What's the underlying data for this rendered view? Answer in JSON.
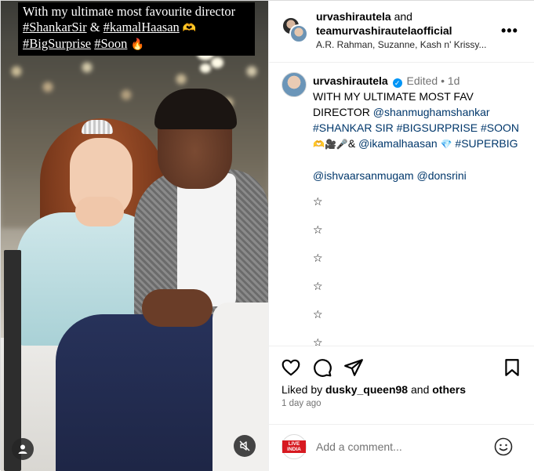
{
  "media": {
    "caption_line1": "With my ultimate most favourite director",
    "caption_tag1": "#ShankarSir",
    "caption_amp": "&",
    "caption_tag2": "#kamalHaasan",
    "caption_emoji1": "🫶",
    "caption_tag3": "#BigSurprise",
    "caption_tag4": "#Soon",
    "caption_emoji2": "🔥",
    "user_tags_icon": "person-icon",
    "mute_icon": "speaker-muted-icon"
  },
  "header": {
    "author1": "urvashirautela",
    "and_label": "and",
    "author2": "teamurvashirautelaofficial",
    "audio": "A.R. Rahman, Suzanne, Kash n' Krissy...",
    "more_label": "•••"
  },
  "post": {
    "username": "urvashirautela",
    "verified_mark": "✓",
    "edited_label": "Edited",
    "separator": "•",
    "age": "1d",
    "text_line": "WITH MY ULTIMATE MOST FAV DIRECTOR",
    "mention1": "@shanmughamshankar",
    "tag_shankar": "#SHANKAR",
    "sir": "SIR",
    "tag_bigsurprise": "#BIGSURPRISE",
    "tag_soon": "#SOON",
    "emojis": "🫶🎥🎤",
    "amp": "&",
    "mention2": "@ikamalhaasan",
    "gem": "💎",
    "tag_superbig": "#SUPERBIG",
    "mention3": "@ishvaarsanmugam",
    "mention4": "@donsrini",
    "stars": [
      "☆",
      "☆",
      "☆",
      "☆",
      "☆",
      "☆"
    ]
  },
  "actions": {
    "icons": [
      "heart-icon",
      "comment-icon",
      "share-icon",
      "bookmark-icon"
    ],
    "liked_prefix": "Liked by",
    "liked_user": "dusky_queen98",
    "liked_and": "and",
    "liked_others": "others",
    "time": "1 day ago"
  },
  "comment": {
    "avatar_text": "LIVE INDIA",
    "placeholder": "Add a comment...",
    "emoji_icon": "smiley-icon"
  },
  "colors": {
    "link": "#00376b",
    "verified": "#0095f6",
    "muted": "#737373"
  }
}
